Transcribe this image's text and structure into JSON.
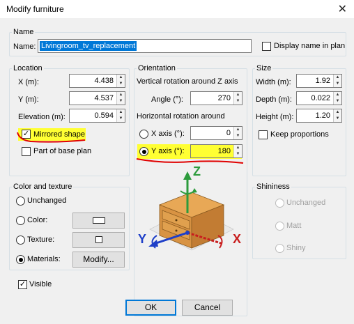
{
  "window": {
    "title": "Modify furniture",
    "close_glyph": "✕"
  },
  "name_group": {
    "legend": "Name",
    "label": "Name:",
    "value": "Livingroom_tv_replacement",
    "display_in_plan_label": "Display name in plan",
    "display_in_plan_checked": false
  },
  "location": {
    "legend": "Location",
    "x_label": "X (m):",
    "x_value": "4.438",
    "y_label": "Y (m):",
    "y_value": "4.537",
    "elevation_label": "Elevation (m):",
    "elevation_value": "0.594",
    "mirrored_label": "Mirrored shape",
    "mirrored_checked": true,
    "base_plan_label": "Part of base plan",
    "base_plan_checked": false
  },
  "orientation": {
    "legend": "Orientation",
    "vertical_caption": "Vertical rotation around Z axis",
    "angle_label": "Angle (°):",
    "angle_value": "270",
    "horizontal_caption": "Horizontal rotation around",
    "x_axis_label": "X axis (°):",
    "x_axis_value": "0",
    "y_axis_label": "Y axis (°):",
    "y_axis_value": "180",
    "selected_axis": "Y",
    "axis_z": "Z",
    "axis_y": "Y",
    "axis_x": "X"
  },
  "size": {
    "legend": "Size",
    "width_label": "Width (m):",
    "width_value": "1.92",
    "depth_label": "Depth (m):",
    "depth_value": "0.022",
    "height_label": "Height (m):",
    "height_value": "1.20",
    "keep_proportions_label": "Keep proportions",
    "keep_proportions_checked": false
  },
  "color_texture": {
    "legend": "Color and texture",
    "unchanged_label": "Unchanged",
    "color_label": "Color:",
    "texture_label": "Texture:",
    "materials_label": "Materials:",
    "modify_label": "Modify...",
    "selected": "Materials"
  },
  "shininess": {
    "legend": "Shininess",
    "unchanged_label": "Unchanged",
    "matt_label": "Matt",
    "shiny_label": "Shiny"
  },
  "visible_label": "Visible",
  "visible_checked": true,
  "ok_label": "OK",
  "cancel_label": "Cancel",
  "colors": {
    "highlight": "#ffff33",
    "annotation_red": "#e00000",
    "accent": "#0078d7"
  }
}
